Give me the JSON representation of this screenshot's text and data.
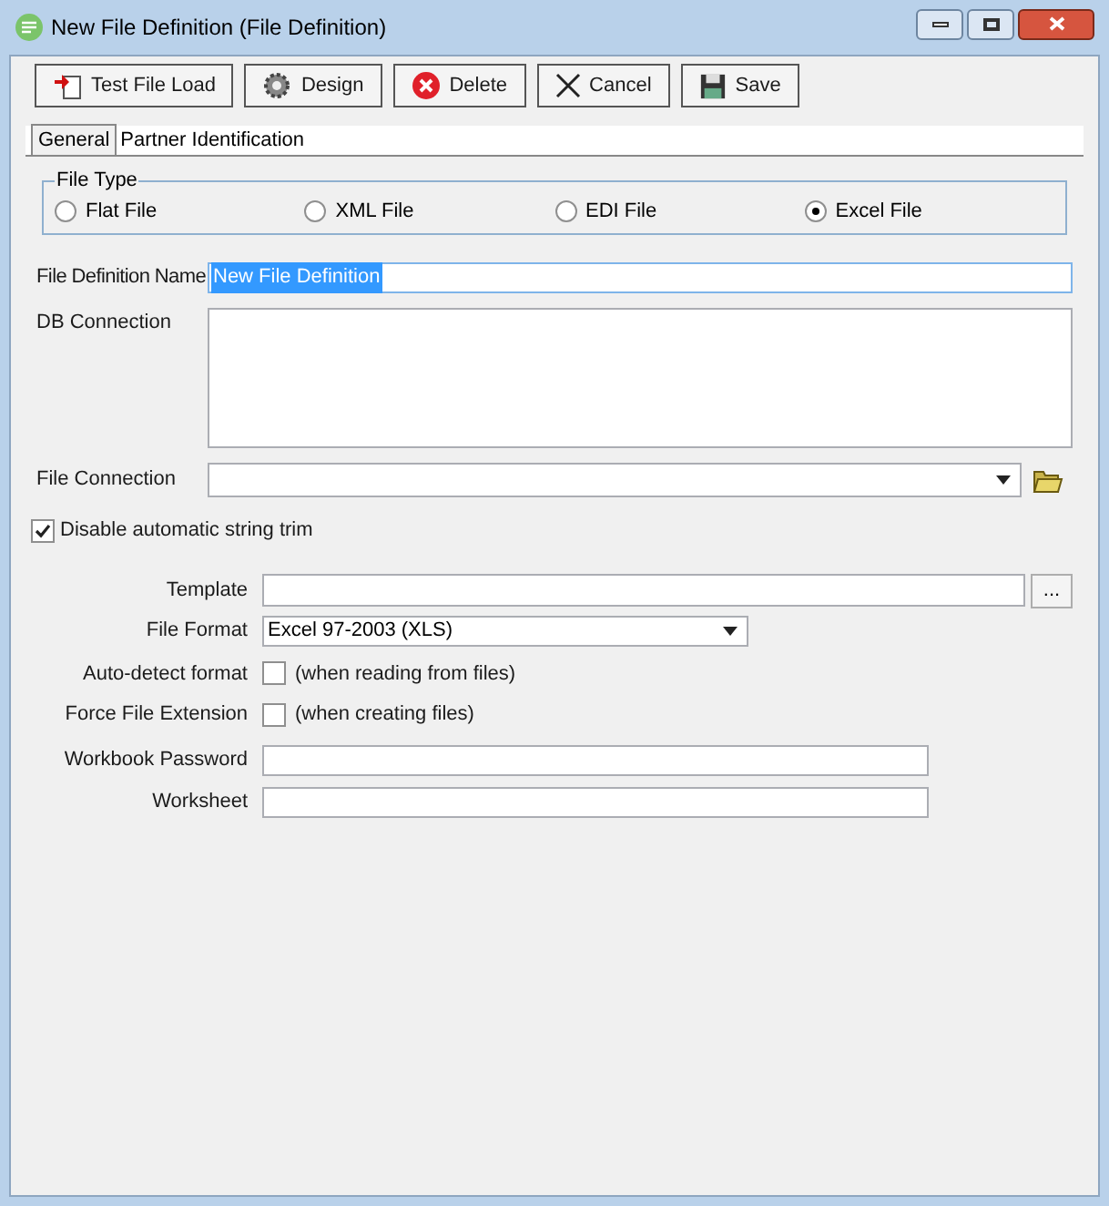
{
  "window": {
    "title": "New File Definition (File Definition)"
  },
  "toolbar": [
    {
      "label": "Test File Load",
      "kind": "test"
    },
    {
      "label": "Design",
      "kind": "design"
    },
    {
      "label": "Delete",
      "kind": "delete"
    },
    {
      "label": "Cancel",
      "kind": "cancel"
    },
    {
      "label": "Save",
      "kind": "save"
    }
  ],
  "tabs": [
    {
      "label": "General",
      "selected": true
    },
    {
      "label": "Partner Identification",
      "selected": false
    }
  ],
  "file_type": {
    "legend": "File Type",
    "options": [
      {
        "label": "Flat File",
        "selected": false
      },
      {
        "label": "XML File",
        "selected": false
      },
      {
        "label": "EDI File",
        "selected": false
      },
      {
        "label": "Excel File",
        "selected": true
      }
    ]
  },
  "file_definition_name": {
    "label": "File Definition Name",
    "value": "New File Definition"
  },
  "db_connection": {
    "label": "DB Connection"
  },
  "file_connection": {
    "label": "File Connection"
  },
  "disable_trim": {
    "label": "Disable automatic string trim",
    "checked": true
  },
  "template": {
    "label": "Template",
    "browse": "..."
  },
  "file_format": {
    "label": "File Format",
    "value": "Excel 97-2003 (XLS)"
  },
  "auto_detect": {
    "label": "Auto-detect format",
    "checked": false,
    "note": "(when reading from files)"
  },
  "force_extension": {
    "label": "Force File Extension",
    "checked": false,
    "note": "(when creating files)"
  },
  "workbook_password": {
    "label": "Workbook Password"
  },
  "worksheet": {
    "label": "Worksheet"
  }
}
